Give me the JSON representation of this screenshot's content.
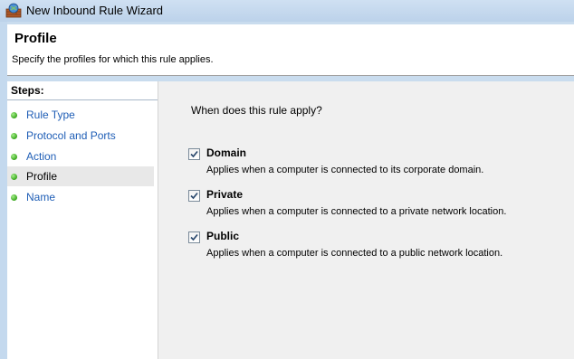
{
  "window": {
    "title": "New Inbound Rule Wizard",
    "icon": "firewall-wizard-icon"
  },
  "header": {
    "title": "Profile",
    "subtitle": "Specify the profiles for which this rule applies."
  },
  "steps": {
    "title": "Steps:",
    "items": [
      {
        "label": "Rule Type",
        "active": false
      },
      {
        "label": "Protocol and Ports",
        "active": false
      },
      {
        "label": "Action",
        "active": false
      },
      {
        "label": "Profile",
        "active": true
      },
      {
        "label": "Name",
        "active": false
      }
    ]
  },
  "main": {
    "question": "When does this rule apply?",
    "options": [
      {
        "label": "Domain",
        "checked": true,
        "description": "Applies when a computer is connected to its corporate domain."
      },
      {
        "label": "Private",
        "checked": true,
        "description": "Applies when a computer is connected to a private network location."
      },
      {
        "label": "Public",
        "checked": true,
        "description": "Applies when a computer is connected to a public network location."
      }
    ]
  },
  "colors": {
    "link": "#1f5eb6",
    "step_bullet": "#38a71c",
    "content_bg": "#f0f0f0"
  }
}
